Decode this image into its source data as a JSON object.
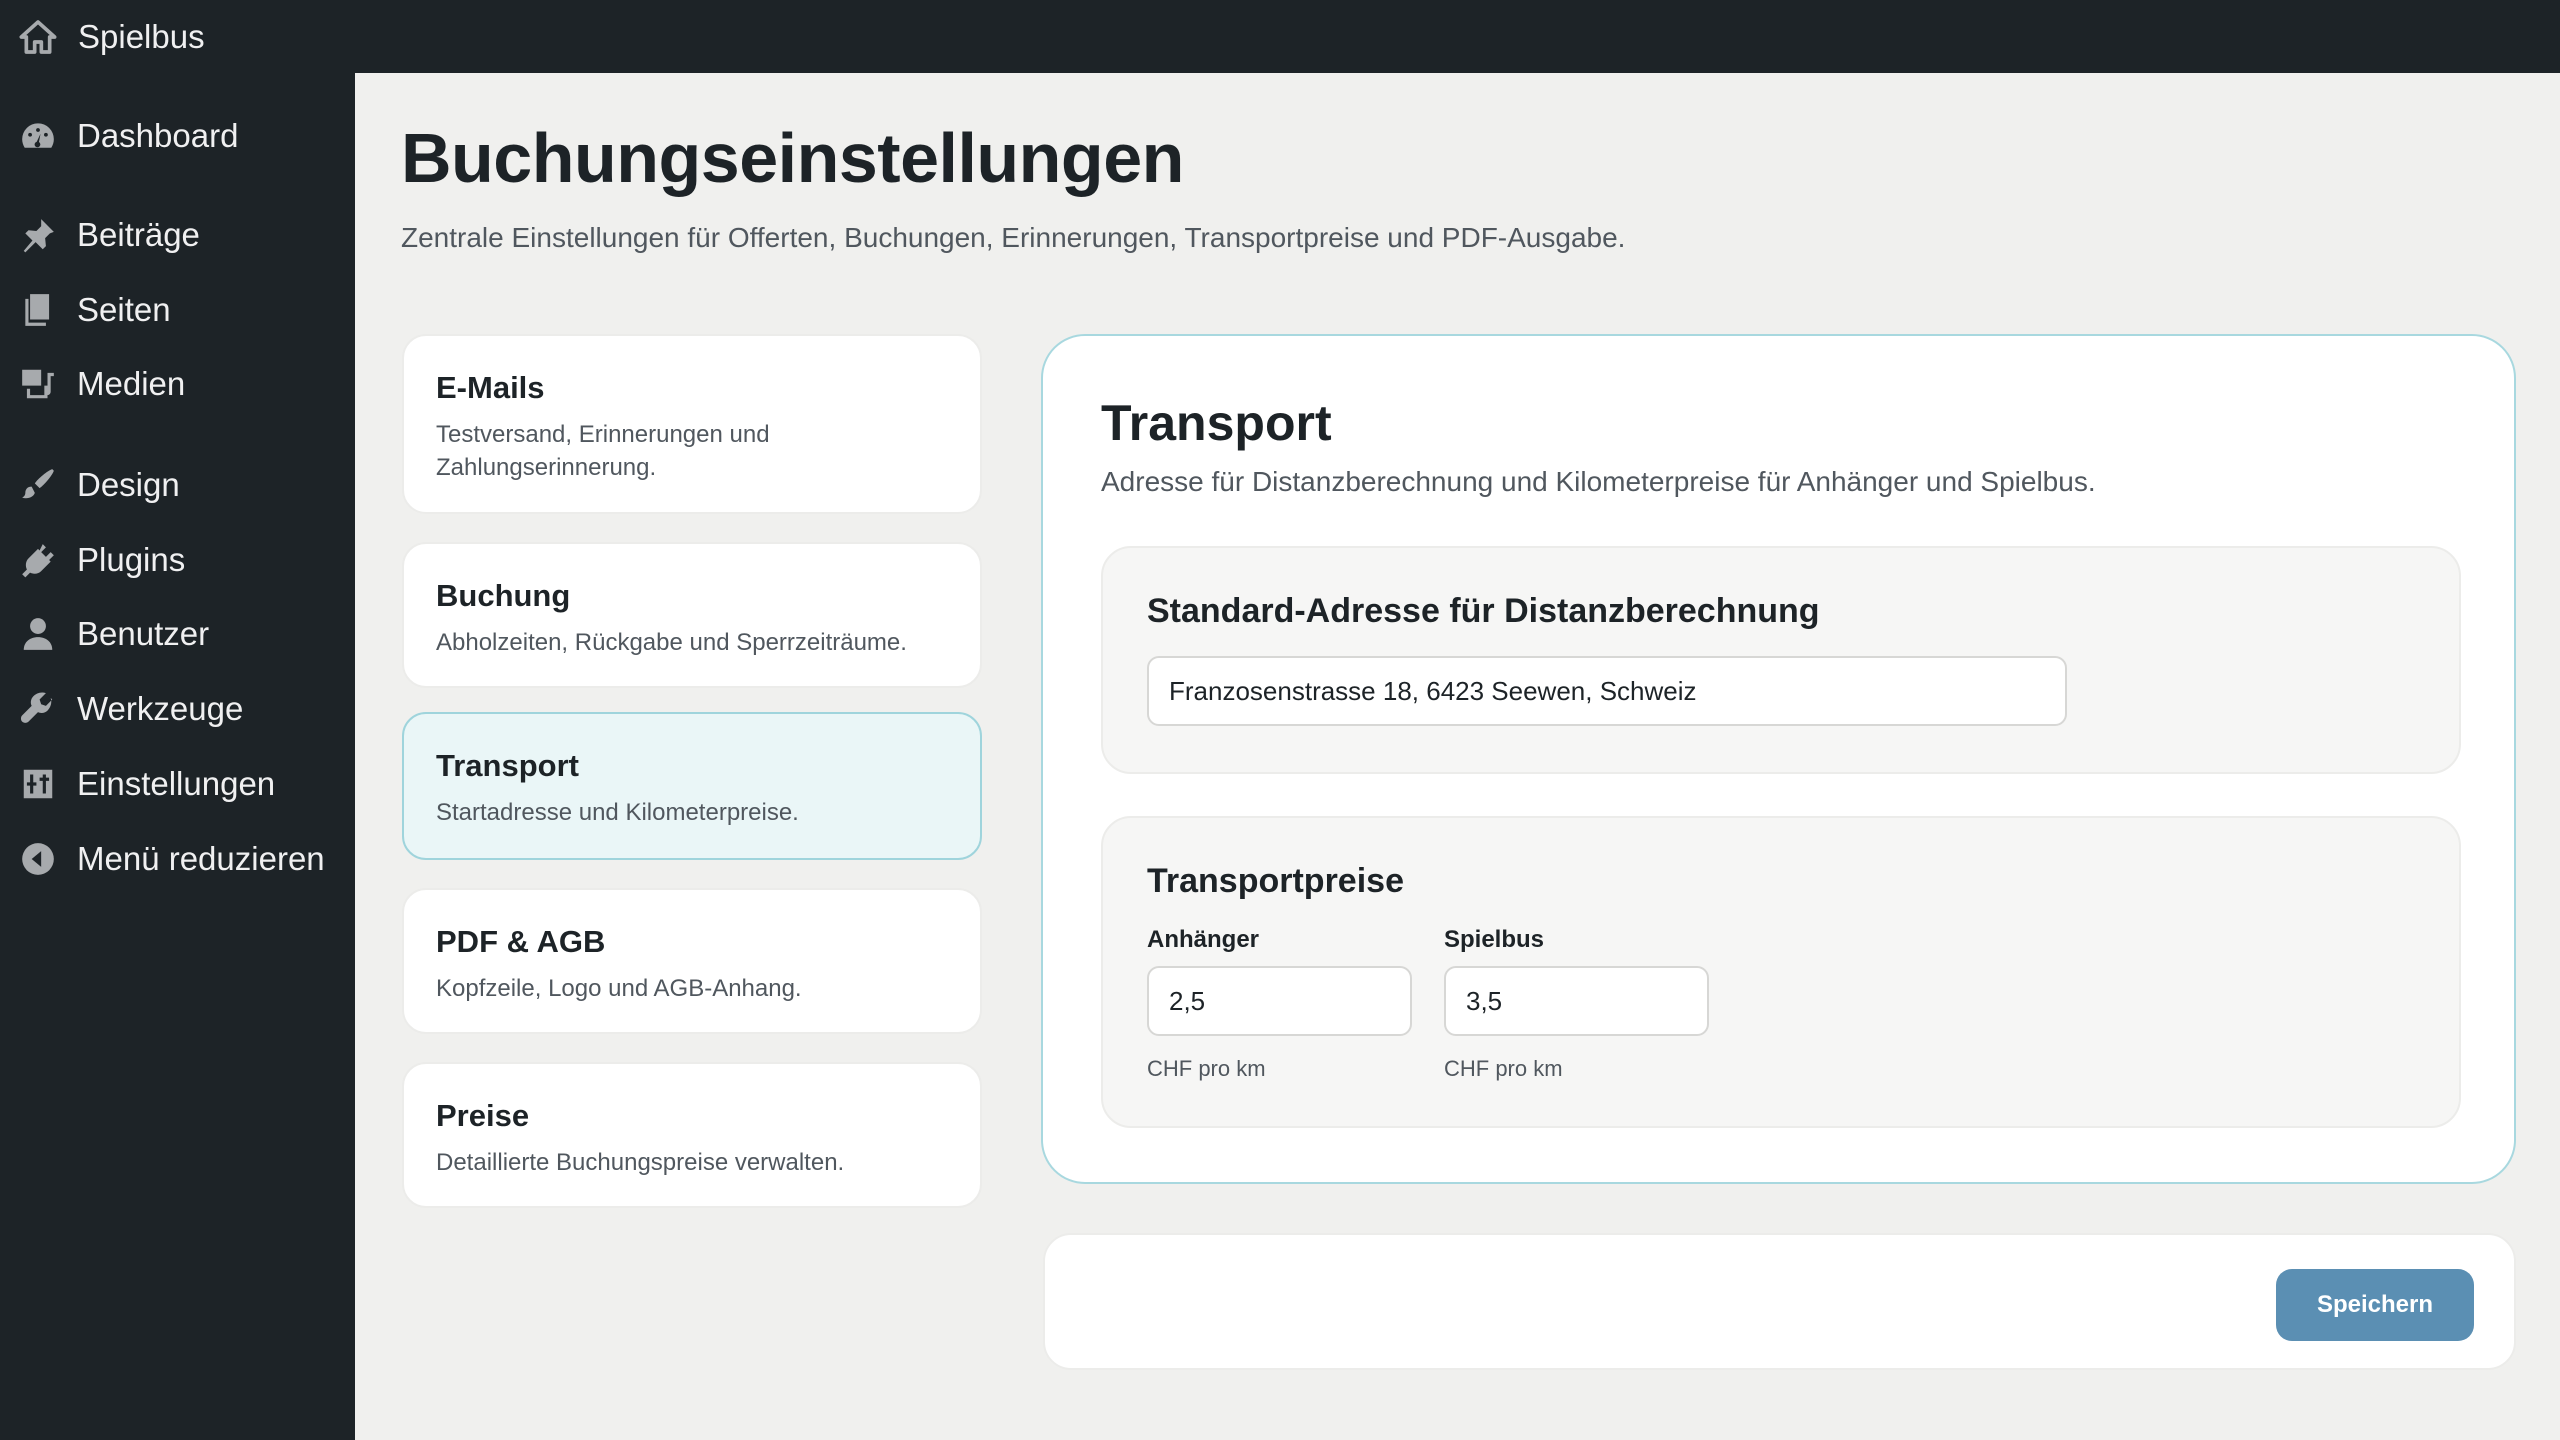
{
  "adminbar": {
    "site_name": "Spielbus"
  },
  "sidebar": {
    "items": [
      {
        "label": "Dashboard",
        "icon": "dashboard-icon"
      },
      {
        "label": "Beiträge",
        "icon": "pin-icon"
      },
      {
        "label": "Seiten",
        "icon": "pages-icon"
      },
      {
        "label": "Medien",
        "icon": "media-icon"
      },
      {
        "label": "Design",
        "icon": "brush-icon"
      },
      {
        "label": "Plugins",
        "icon": "plugin-icon"
      },
      {
        "label": "Benutzer",
        "icon": "user-icon"
      },
      {
        "label": "Werkzeuge",
        "icon": "wrench-icon"
      },
      {
        "label": "Einstellungen",
        "icon": "settings-icon"
      },
      {
        "label": "Menü reduzieren",
        "icon": "collapse-icon"
      }
    ]
  },
  "page": {
    "title": "Buchungseinstellungen",
    "subtitle": "Zentrale Einstellungen für Offerten, Buchungen, Erinnerungen, Transportpreise und PDF-Ausgabe."
  },
  "cards": [
    {
      "title": "E-Mails",
      "desc": "Testversand, Erinnerungen und Zahlungserinnerung."
    },
    {
      "title": "Buchung",
      "desc": "Abholzeiten, Rückgabe und Sperrzeiträume."
    },
    {
      "title": "Transport",
      "desc": "Startadresse und Kilometerpreise."
    },
    {
      "title": "PDF & AGB",
      "desc": "Kopfzeile, Logo und AGB-Anhang."
    },
    {
      "title": "Preise",
      "desc": "Detaillierte Buchungspreise verwalten."
    }
  ],
  "active_card": "Transport",
  "panel": {
    "title": "Transport",
    "subtitle": "Adresse für Distanzberechnung und Kilometerpreise für Anhänger und Spielbus.",
    "address_section": {
      "title": "Standard-Adresse für Distanzberechnung",
      "value": "Franzosenstrasse 18, 6423 Seewen, Schweiz"
    },
    "prices_section": {
      "title": "Transportpreise",
      "trailer": {
        "label": "Anhänger",
        "value": "2,5",
        "help": "CHF pro km"
      },
      "bus": {
        "label": "Spielbus",
        "value": "3,5",
        "help": "CHF pro km"
      }
    }
  },
  "footer": {
    "save_label": "Speichern"
  },
  "colors": {
    "sidebar_bg": "#1d2327",
    "accent_border": "#a8d8df",
    "active_card_bg": "#eaf6f7",
    "button": "#5b8fb3"
  }
}
